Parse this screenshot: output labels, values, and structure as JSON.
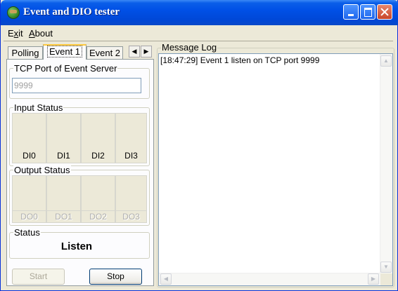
{
  "window": {
    "title": "Event and DIO tester"
  },
  "menu": {
    "exit": "Exit",
    "about": "About"
  },
  "tabs": {
    "items": [
      "Polling",
      "Event 1",
      "Event 2"
    ],
    "active": "Event 1"
  },
  "tcp": {
    "label": "TCP Port of Event Server",
    "value": "9999"
  },
  "input_status": {
    "label": "Input Status",
    "channels": [
      "DI0",
      "DI1",
      "DI2",
      "DI3"
    ]
  },
  "output_status": {
    "label": "Output Status",
    "channels": [
      "DO0",
      "DO1",
      "DO2",
      "DO3"
    ]
  },
  "status": {
    "label": "Status",
    "value": "Listen"
  },
  "buttons": {
    "start": "Start",
    "stop": "Stop"
  },
  "log": {
    "label": "Message Log",
    "lines": [
      "[18:47:29] Event 1 listen on TCP port 9999"
    ]
  },
  "colors": {
    "titlebar": "#0050e6",
    "window_bg": "#ece9d8",
    "active_tab_highlight": "#ffc83c"
  }
}
